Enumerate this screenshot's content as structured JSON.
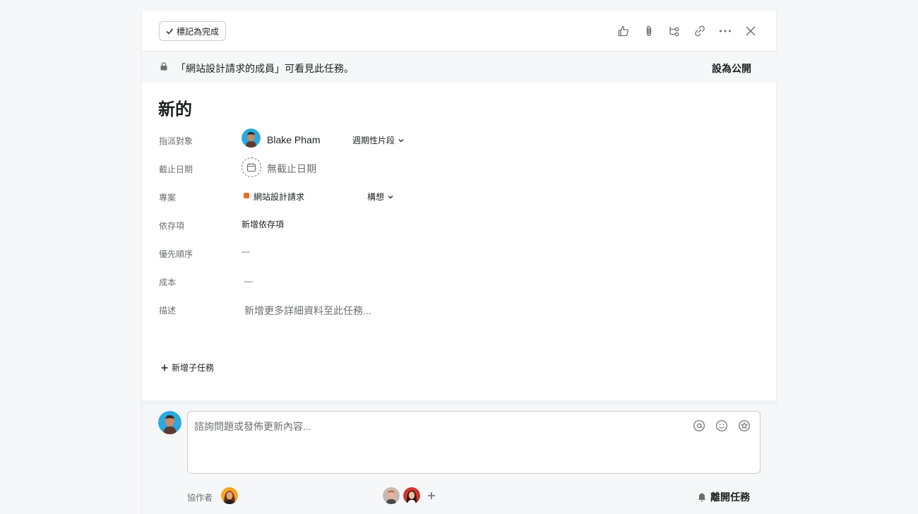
{
  "toolbar": {
    "mark_complete_label": "標記為完成",
    "icons": [
      "like-icon",
      "attachment-icon",
      "subtask-icon",
      "link-icon",
      "more-icon",
      "close-icon"
    ]
  },
  "privacy_banner": {
    "message": "「網站設計請求的成員」可看見此任務。",
    "make_public_label": "設為公開"
  },
  "task": {
    "title": "新的",
    "fields": {
      "assignee_label": "指派對象",
      "assignee_name": "Blake Pham",
      "assignee_section_label": "週期性片段",
      "due_date_label": "截止日期",
      "due_date_value": "無截止日期",
      "project_label": "專案",
      "project_name": "網站設計請求",
      "project_color": "#f06a2a",
      "project_section_label": "構想",
      "dependencies_label": "依存項",
      "dependencies_add": "新增依存項",
      "priority_label": "優先順序",
      "priority_value": "—",
      "cost_label": "成本",
      "cost_value": "—",
      "description_label": "描述",
      "description_placeholder": "新增更多詳細資料至此任務..."
    },
    "add_subtask_label": "新增子任務"
  },
  "comment": {
    "placeholder": "諮詢問題或發佈更新內容...",
    "icons": [
      "mention-icon",
      "emoji-icon",
      "star-icon"
    ]
  },
  "collaborators": {
    "label": "協作者",
    "leave_label": "離開任務"
  },
  "colors": {
    "accent_orange": "#f06a2a",
    "avatar_blue": "#2ba8e0"
  }
}
